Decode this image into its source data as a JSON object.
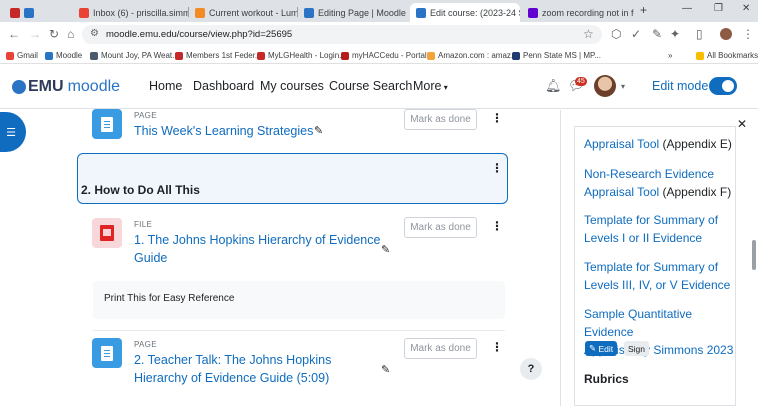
{
  "browser": {
    "tabs": [
      {
        "label": "Inbox (6) - priscilla.simm",
        "color": "#ea4335"
      },
      {
        "label": "Current workout - Lumo",
        "color": "#f28b24"
      },
      {
        "label": "Editing Page | Moodle",
        "color": "#2a73c5"
      },
      {
        "label": "Edit course: (2023-24 SU",
        "color": "#2a73c5"
      },
      {
        "label": "zoom recording not in fo",
        "color": "#6001d2"
      }
    ],
    "url": "moodle.emu.edu/course/view.php?id=25695",
    "bookmarks": [
      {
        "label": "Gmail",
        "color": "#ea4335"
      },
      {
        "label": "Moodle",
        "color": "#2a73c5"
      },
      {
        "label": "Mount Joy, PA Weat...",
        "color": "#4a5a6a"
      },
      {
        "label": "Members 1st Feder...",
        "color": "#c62828"
      },
      {
        "label": "MyLGHealth - Login...",
        "color": "#c62828"
      },
      {
        "label": "myHACCedu - Portal",
        "color": "#b71c1c"
      },
      {
        "label": "Amazon.com : amaz...",
        "color": "#f2a33a"
      },
      {
        "label": "Penn State MS | MP...",
        "color": "#1e3a6e"
      }
    ],
    "all_bookmarks": "All Bookmarks"
  },
  "navbar": {
    "logo_text": "EMU",
    "logo_suffix": "moodle",
    "links": [
      "Home",
      "Dashboard",
      "My courses",
      "Course Search",
      "More"
    ],
    "messages_count": "45",
    "edit_mode_label": "Edit mode"
  },
  "activities": [
    {
      "type": "PAGE",
      "title": "This Week's Learning Strategies",
      "mark": "Mark as done"
    },
    {
      "type": "FILE",
      "title_lines": [
        "1. The Johns Hopkins Hierarchy of Evidence",
        "Guide"
      ],
      "mark": "Mark as done"
    },
    {
      "type": "PAGE",
      "title_lines": [
        "2. Teacher Talk: The Johns Hopkins",
        "Hierarchy of Evidence Guide (5:09)"
      ],
      "mark": "Mark as done"
    }
  ],
  "section": {
    "title": "2. How to Do All This"
  },
  "file_description": "Print This for Easy Reference",
  "help_label": "?",
  "drawer": {
    "links": [
      {
        "text": "Appraisal Tool",
        "suffix": " (Appendix E)"
      },
      {
        "text": "Non-Research Evidence",
        "text2": "Appraisal Tool",
        "suffix": " (Appendix F)"
      },
      {
        "text": "Template for Summary of",
        "text2": "Levels I or II Evidence"
      },
      {
        "text": "Template for Summary of",
        "text2": "Levels III, IV, or V Evidence"
      },
      {
        "text": "Sample Quantitative Evidence",
        "text2": "Appraisal by Simmons 2023"
      }
    ],
    "edit_label": "Edit",
    "sign_label": "Sign",
    "rubrics_heading": "Rubrics"
  },
  "colors": {
    "accent": "#0f6cbf",
    "page_icon": "#399be2",
    "pdf_red": "#e02424"
  }
}
